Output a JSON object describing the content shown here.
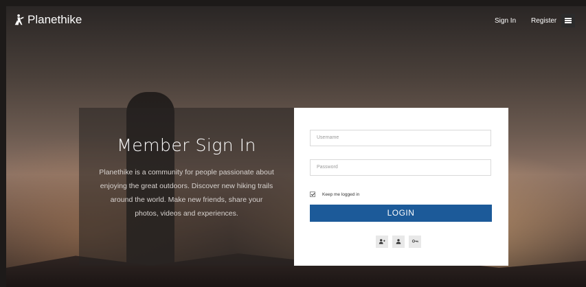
{
  "header": {
    "brand": "Planethike",
    "signin_label": "Sign In",
    "register_label": "Register"
  },
  "hero": {
    "title": "Member Sign In",
    "description": "Planethike is a community for people passionate about enjoying the great outdoors. Discover new hiking trails around the world. Make new friends, share your photos, videos and experiences."
  },
  "form": {
    "username_placeholder": "Username",
    "password_placeholder": "Password",
    "remember_label": "Keep me logged in",
    "remember_checked": true,
    "login_label": "LOGIN"
  },
  "actions": {
    "icons": [
      "add-user-icon",
      "user-icon",
      "key-icon"
    ]
  },
  "colors": {
    "accent": "#1c5a99"
  }
}
